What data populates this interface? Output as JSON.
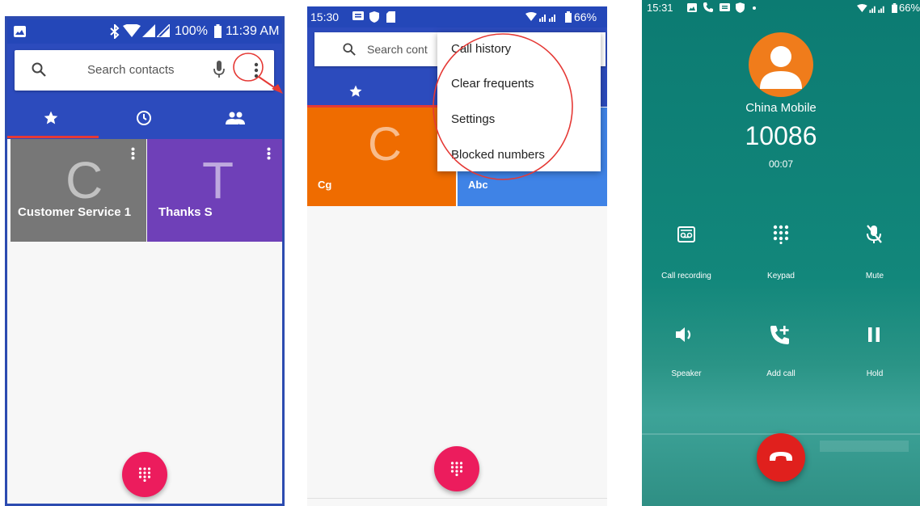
{
  "panel1": {
    "status": {
      "time": "11:39 AM",
      "battery": "100%"
    },
    "search": {
      "placeholder": "Search contacts"
    },
    "tiles": [
      {
        "letter": "C",
        "name": "Customer Service 1",
        "color": "#777777"
      },
      {
        "letter": "T",
        "name": "Thanks S",
        "color": "#6f40b8"
      }
    ],
    "icons": {
      "search": "search-icon",
      "mic": "mic-icon",
      "more": "more-vert-icon",
      "star": "star-icon",
      "recents": "clock-icon",
      "contacts": "people-icon",
      "dialpad": "dialpad-icon"
    }
  },
  "panel2": {
    "status": {
      "time": "15:30",
      "battery": "66%"
    },
    "search": {
      "placeholder": "Search cont"
    },
    "menu": [
      "Call history",
      "Clear frequents",
      "Settings",
      "Blocked numbers"
    ],
    "tiles": [
      {
        "letter": "C",
        "name": "Cg",
        "color": "#ef6c00"
      },
      {
        "name": "Abc",
        "color": "#3f83e6"
      }
    ]
  },
  "panel3": {
    "status": {
      "time": "15:31",
      "battery": "66%"
    },
    "caller": {
      "name": "China Mobile",
      "number": "10086",
      "duration": "00:07"
    },
    "actions": [
      {
        "label": "Call recording",
        "icon": "voicemail-icon"
      },
      {
        "label": "Keypad",
        "icon": "dialpad-icon"
      },
      {
        "label": "Mute",
        "icon": "mic-off-icon"
      },
      {
        "label": "Speaker",
        "icon": "speaker-icon"
      },
      {
        "label": "Add call",
        "icon": "add-call-icon"
      },
      {
        "label": "Hold",
        "icon": "pause-icon"
      }
    ],
    "colors": {
      "end_call": "#e0201d",
      "background": "#0f8176"
    }
  },
  "colors": {
    "primary": "#2c4bbd",
    "accent": "#ec1c5d",
    "annotation": "#e53935"
  }
}
